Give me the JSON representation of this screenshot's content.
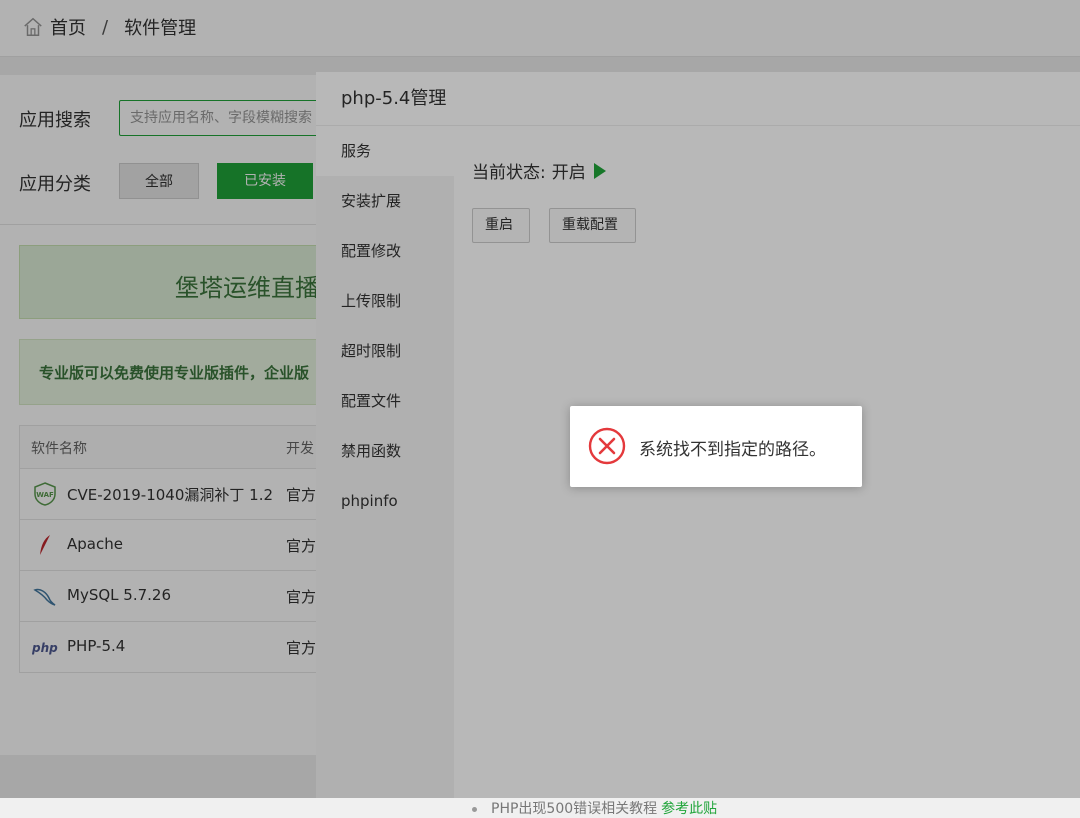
{
  "breadcrumb": {
    "home": "首页",
    "separator": "/",
    "current": "软件管理"
  },
  "search": {
    "label": "应用搜索",
    "placeholder": "支持应用名称、字段模糊搜索"
  },
  "category": {
    "label": "应用分类",
    "all": "全部",
    "installed": "已安装"
  },
  "banners": {
    "ops_live": "堡塔运维直播",
    "pro_notice": "专业版可以免费使用专业版插件，企业版"
  },
  "table": {
    "headers": {
      "name": "软件名称",
      "developer": "开发"
    },
    "rows": [
      {
        "icon": "waf-icon",
        "name": "CVE-2019-1040漏洞补丁 1.2",
        "developer": "官方"
      },
      {
        "icon": "apache-feather-icon",
        "name": "Apache",
        "developer": "官方"
      },
      {
        "icon": "mysql-dolphin-icon",
        "name": "MySQL 5.7.26",
        "developer": "官方"
      },
      {
        "icon": "php-icon",
        "name": "PHP-5.4",
        "developer": "官方"
      }
    ]
  },
  "layer": {
    "title": "php-5.4管理",
    "menu": [
      "服务",
      "安装扩展",
      "配置修改",
      "上传限制",
      "超时限制",
      "配置文件",
      "禁用函数",
      "phpinfo"
    ],
    "active_menu": "服务",
    "status_label": "当前状态:",
    "status_value": "开启",
    "buttons": {
      "restart": "重启",
      "reload": "重载配置"
    },
    "help_text": "PHP出现500错误相关教程",
    "help_link": "参考此贴"
  },
  "toast": {
    "icon": "error-x-icon",
    "message": "系统找不到指定的路径。"
  },
  "colors": {
    "accent": "#20a53a",
    "error": "#e4393c"
  }
}
